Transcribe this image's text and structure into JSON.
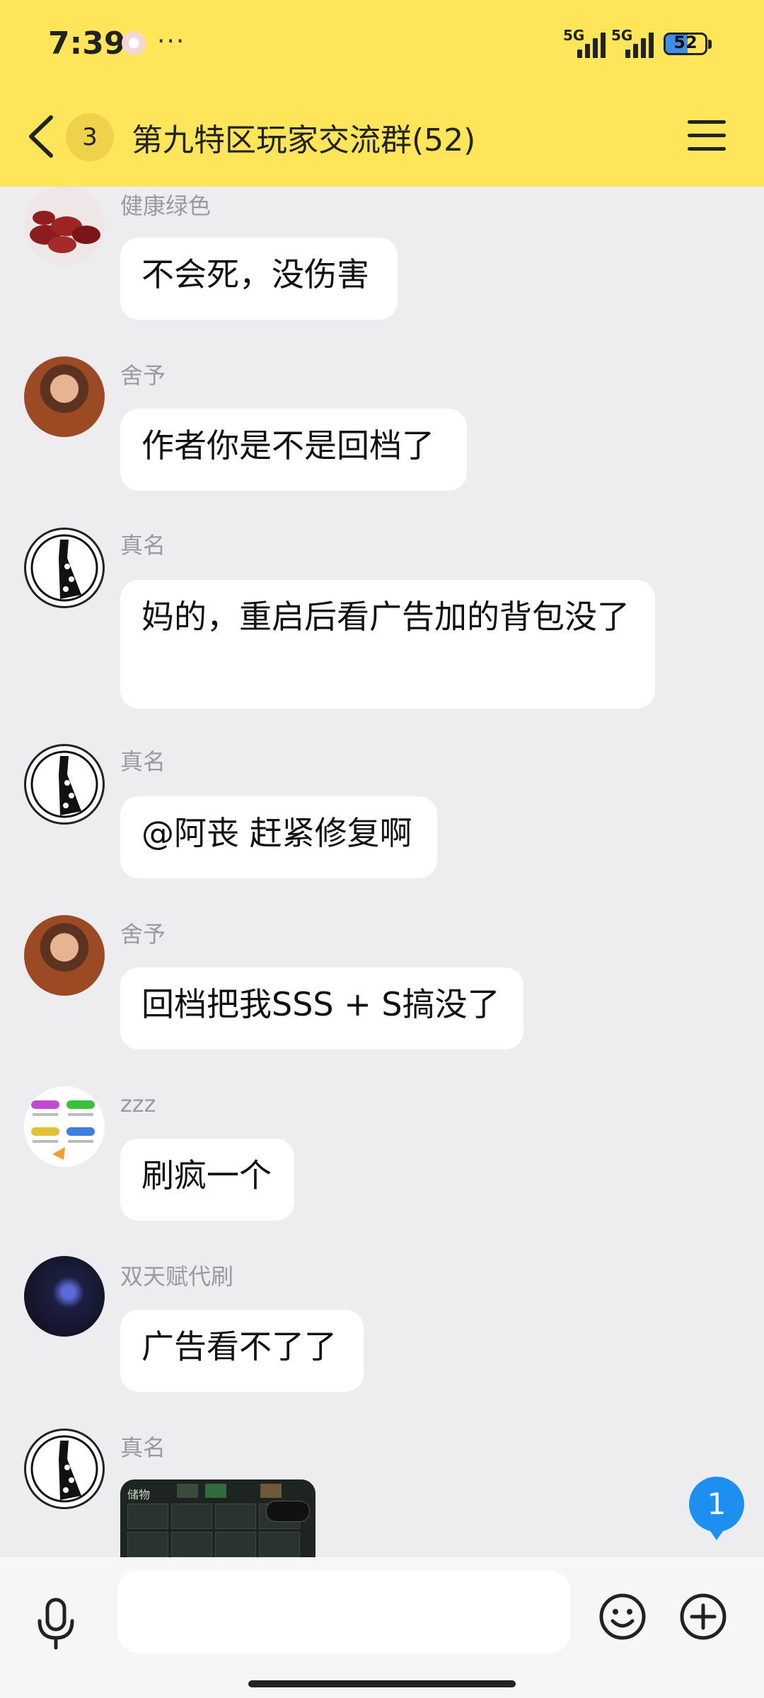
{
  "status_bar": {
    "time": "7:39",
    "more": "···",
    "signal1_label": "5G",
    "signal2_label": "5G",
    "battery": "52"
  },
  "header": {
    "unread_count": "3",
    "title": "第九特区玩家交流群(52)",
    "background_color": "#fee55a"
  },
  "messages": [
    {
      "sender": "健康绿色",
      "text": "不会死，没伤害",
      "avatar_icon": "red-beans-avatar"
    },
    {
      "sender": "舍予",
      "text": "作者你是不是回档了",
      "avatar_icon": "man-photo-avatar"
    },
    {
      "sender": "真名",
      "text": "妈的，重启后看广告加的背包没了",
      "avatar_icon": "giraffe-avatar"
    },
    {
      "sender": "真名",
      "text": "@阿丧 赶紧修复啊",
      "avatar_icon": "giraffe-avatar"
    },
    {
      "sender": "舍予",
      "text": "回档把我SSS + S搞没了",
      "avatar_icon": "man-photo-avatar"
    },
    {
      "sender": "zzz",
      "text": "刷疯一个",
      "avatar_icon": "pills-avatar"
    },
    {
      "sender": "双天赋代刷",
      "text": "广告看不了了",
      "avatar_icon": "anime-avatar"
    },
    {
      "sender": "真名",
      "text": "",
      "avatar_icon": "giraffe-avatar"
    }
  ],
  "image_message": {
    "inventory_title": "储物"
  },
  "new_message_badge": "1",
  "input": {
    "placeholder": ""
  }
}
